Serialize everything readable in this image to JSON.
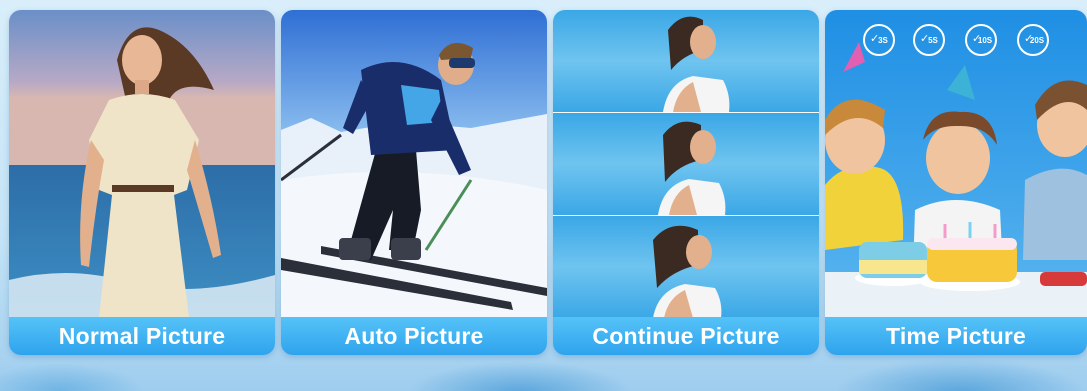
{
  "cards": [
    {
      "label": "Normal Picture",
      "icon": "woman-beach-photo"
    },
    {
      "label": "Auto Picture",
      "icon": "skier-photo"
    },
    {
      "label": "Continue Picture",
      "icon": "runner-burst-photo"
    },
    {
      "label": "Time Picture",
      "icon": "kids-birthday-photo"
    }
  ],
  "timers": [
    "3S",
    "5S",
    "10S",
    "20S"
  ],
  "colors": {
    "label_top": "#56c3f7",
    "label_bottom": "#2ea3ee",
    "background": "#d9eefa"
  }
}
